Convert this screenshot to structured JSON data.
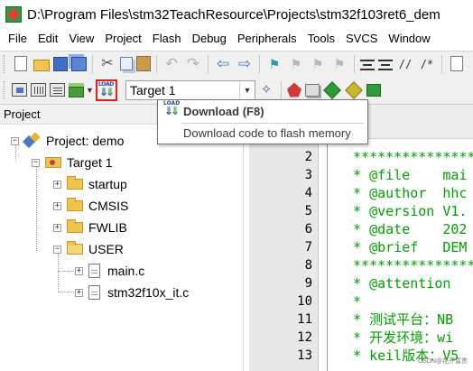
{
  "window": {
    "title": "D:\\Program Files\\stm32TeachResource\\Projects\\stm32f103ret6_dem"
  },
  "menu": [
    "File",
    "Edit",
    "View",
    "Project",
    "Flash",
    "Debug",
    "Peripherals",
    "Tools",
    "SVCS",
    "Window"
  ],
  "toolbar": {
    "target_value": "Target 1",
    "highlight_color": "#e02020"
  },
  "tooltip": {
    "title": "Download (F8)",
    "description": "Download code to flash memory"
  },
  "project_panel": {
    "header": "Project",
    "project_label": "Project: demo",
    "target_label": "Target 1",
    "groups": [
      {
        "label": "startup",
        "expander": "+"
      },
      {
        "label": "CMSIS",
        "expander": "+"
      },
      {
        "label": "FWLIB",
        "expander": "+"
      },
      {
        "label": "USER",
        "expander": "−"
      }
    ],
    "files": [
      {
        "label": "main.c",
        "expander": "+"
      },
      {
        "label": "stm32f10x_it.c",
        "expander": "+"
      }
    ],
    "project_expander": "−",
    "target_expander": "−"
  },
  "editor": {
    "lines": [
      {
        "num": "2",
        "text": " ***************"
      },
      {
        "num": "3",
        "text": " * @file    mai"
      },
      {
        "num": "4",
        "text": " * @author  hhc"
      },
      {
        "num": "5",
        "text": " * @version V1."
      },
      {
        "num": "6",
        "text": " * @date    202"
      },
      {
        "num": "7",
        "text": " * @brief   DEM"
      },
      {
        "num": "8",
        "text": " ***************"
      },
      {
        "num": "9",
        "text": " * @attention"
      },
      {
        "num": "10",
        "text": " *"
      },
      {
        "num": "11",
        "text": " * 测试平台：NB"
      },
      {
        "num": "12",
        "text": " * 开发环境：wi"
      },
      {
        "num": "13",
        "text": " * keil版本：V5"
      }
    ],
    "code_color": "#00a000"
  },
  "watermark": "CSDN@花开富贵"
}
